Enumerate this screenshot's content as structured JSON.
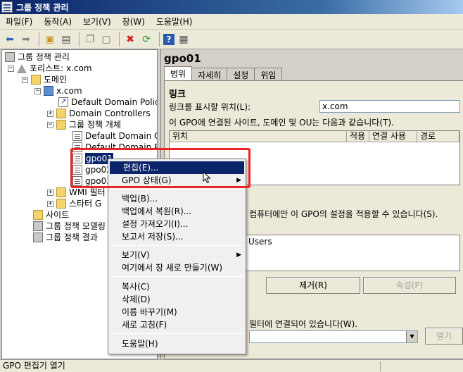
{
  "window": {
    "title": "그룹 정책 관리"
  },
  "menu": [
    "파일(F)",
    "동작(A)",
    "보기(V)",
    "창(W)",
    "도움말(H)"
  ],
  "toolbar": [
    "back-icon",
    "forward-icon",
    "up-folder-icon",
    "show-hide-tree-icon",
    "copy-icon",
    "paste-icon",
    "delete-icon",
    "refresh-icon",
    "help-icon",
    "properties-icon"
  ],
  "tree": {
    "items": [
      {
        "label": "그룹 정책 관리"
      },
      {
        "label": "포리스트: x.com"
      },
      {
        "label": "도메인"
      },
      {
        "label": "x.com"
      },
      {
        "label": "Default Domain Polic"
      },
      {
        "label": "Domain Controllers"
      },
      {
        "label": "그룹 정책 개체"
      },
      {
        "label": "Default Domain C"
      },
      {
        "label": "Default Domain Po"
      },
      {
        "label": "gpo01"
      },
      {
        "label": "gpo02"
      },
      {
        "label": "gpo03"
      },
      {
        "label": "WMI 필터"
      },
      {
        "label": "스타터 G"
      },
      {
        "label": "사이트"
      },
      {
        "label": "그룹 정책 모델링"
      },
      {
        "label": "그룹 정책 결과"
      }
    ]
  },
  "detail": {
    "title": "gpo01",
    "tabs": [
      "범위",
      "자세히",
      "설정",
      "위임"
    ],
    "links_heading": "링크",
    "display_location_label": "링크를 표시할 위치(L):",
    "display_location_value": "x.com",
    "links_desc": "이 GPO에 연결된 사이트, 도메인 및 OU는 다음과 같습니다(T).",
    "columns": [
      "위치",
      "적용",
      "연결 사용",
      "경로"
    ],
    "security_filter_text": "컴퓨터에만 이 GPO의 설정을 적용할 수 있습니다(S).",
    "security_users": "Users",
    "remove_button": "제거(R)",
    "properties_button": "속성(P)",
    "wmi_text": "필터에 연결되어 있습니다(W).",
    "open_button": "열기"
  },
  "context_menu": {
    "edit": "편집(E)...",
    "gpo_status": "GPO 상태(G)",
    "backup": "백업(B)...",
    "restore": "백업에서 복원(R)...",
    "import": "설정 가져오기(I)...",
    "save_report": "보고서 저장(S)...",
    "view": "보기(V)",
    "new_window": "여기에서 창 새로 만들기(W)",
    "copy": "복사(C)",
    "delete": "삭제(D)",
    "rename": "이름 바꾸기(M)",
    "refresh": "새로 고침(F)",
    "help": "도움말(H)"
  },
  "status": {
    "text": "GPO 편집기 열기"
  },
  "colors": {
    "highlight": "#0a246a",
    "annotation": "#ee2424"
  }
}
